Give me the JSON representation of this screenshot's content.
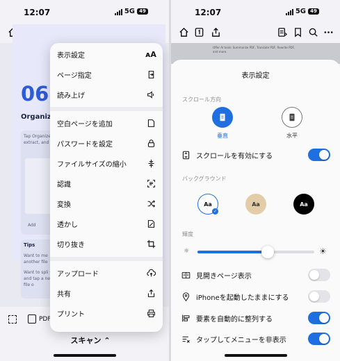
{
  "status": {
    "time": "12:07",
    "network": "5G",
    "battery": "49"
  },
  "left": {
    "doc": {
      "number": "06",
      "heading": "Organize",
      "card_text": "Tap Organize, extract, and",
      "card_btn": "Add",
      "tips_title": "Tips",
      "tips_text1": "Want to me another file",
      "tips_text2": "Want to spli split and tap a new file o"
    },
    "menu": {
      "items": [
        {
          "label": "表示設定",
          "icon": "text-size-icon"
        },
        {
          "label": "ページ指定",
          "icon": "page-jump-icon"
        },
        {
          "label": "読み上げ",
          "icon": "speaker-icon"
        },
        {
          "label": "空白ページを追加",
          "icon": "blank-page-icon"
        },
        {
          "label": "パスワードを設定",
          "icon": "lock-icon"
        },
        {
          "label": "ファイルサイズの縮小",
          "icon": "compress-icon"
        },
        {
          "label": "認識",
          "icon": "ocr-icon"
        },
        {
          "label": "変換",
          "icon": "shuffle-icon"
        },
        {
          "label": "透かし",
          "icon": "watermark-icon"
        },
        {
          "label": "切り抜き",
          "icon": "crop-icon"
        },
        {
          "label": "アップロード",
          "icon": "cloud-upload-icon"
        },
        {
          "label": "共有",
          "icon": "share-icon"
        },
        {
          "label": "プリント",
          "icon": "printer-icon"
        }
      ]
    },
    "bottom": {
      "pdf_label": "PDF",
      "scan_label": "スキャン"
    }
  },
  "right": {
    "preview_text": "Offer AI tools: Summarize PDF, Translate PDF, Rewrite PDF, and more.",
    "sheet": {
      "title": "表示設定",
      "scroll_section": "スクロール方向",
      "vertical_label": "垂直",
      "horizontal_label": "水平",
      "enable_scroll": "スクロールを有効にする",
      "background_section": "バックグラウンド",
      "bg_sample": "Aa",
      "brightness_section": "輝度",
      "brightness_level": 0.6,
      "spread_view": "見開きページ表示",
      "keep_awake": "iPhoneを起動したままにする",
      "auto_arrange": "要素を自動的に整列する",
      "tap_hide_menu": "タップしてメニューを非表示"
    }
  },
  "colors": {
    "accent": "#1f6fe0",
    "sepia": "#e3cda9",
    "dark": "#000000"
  }
}
